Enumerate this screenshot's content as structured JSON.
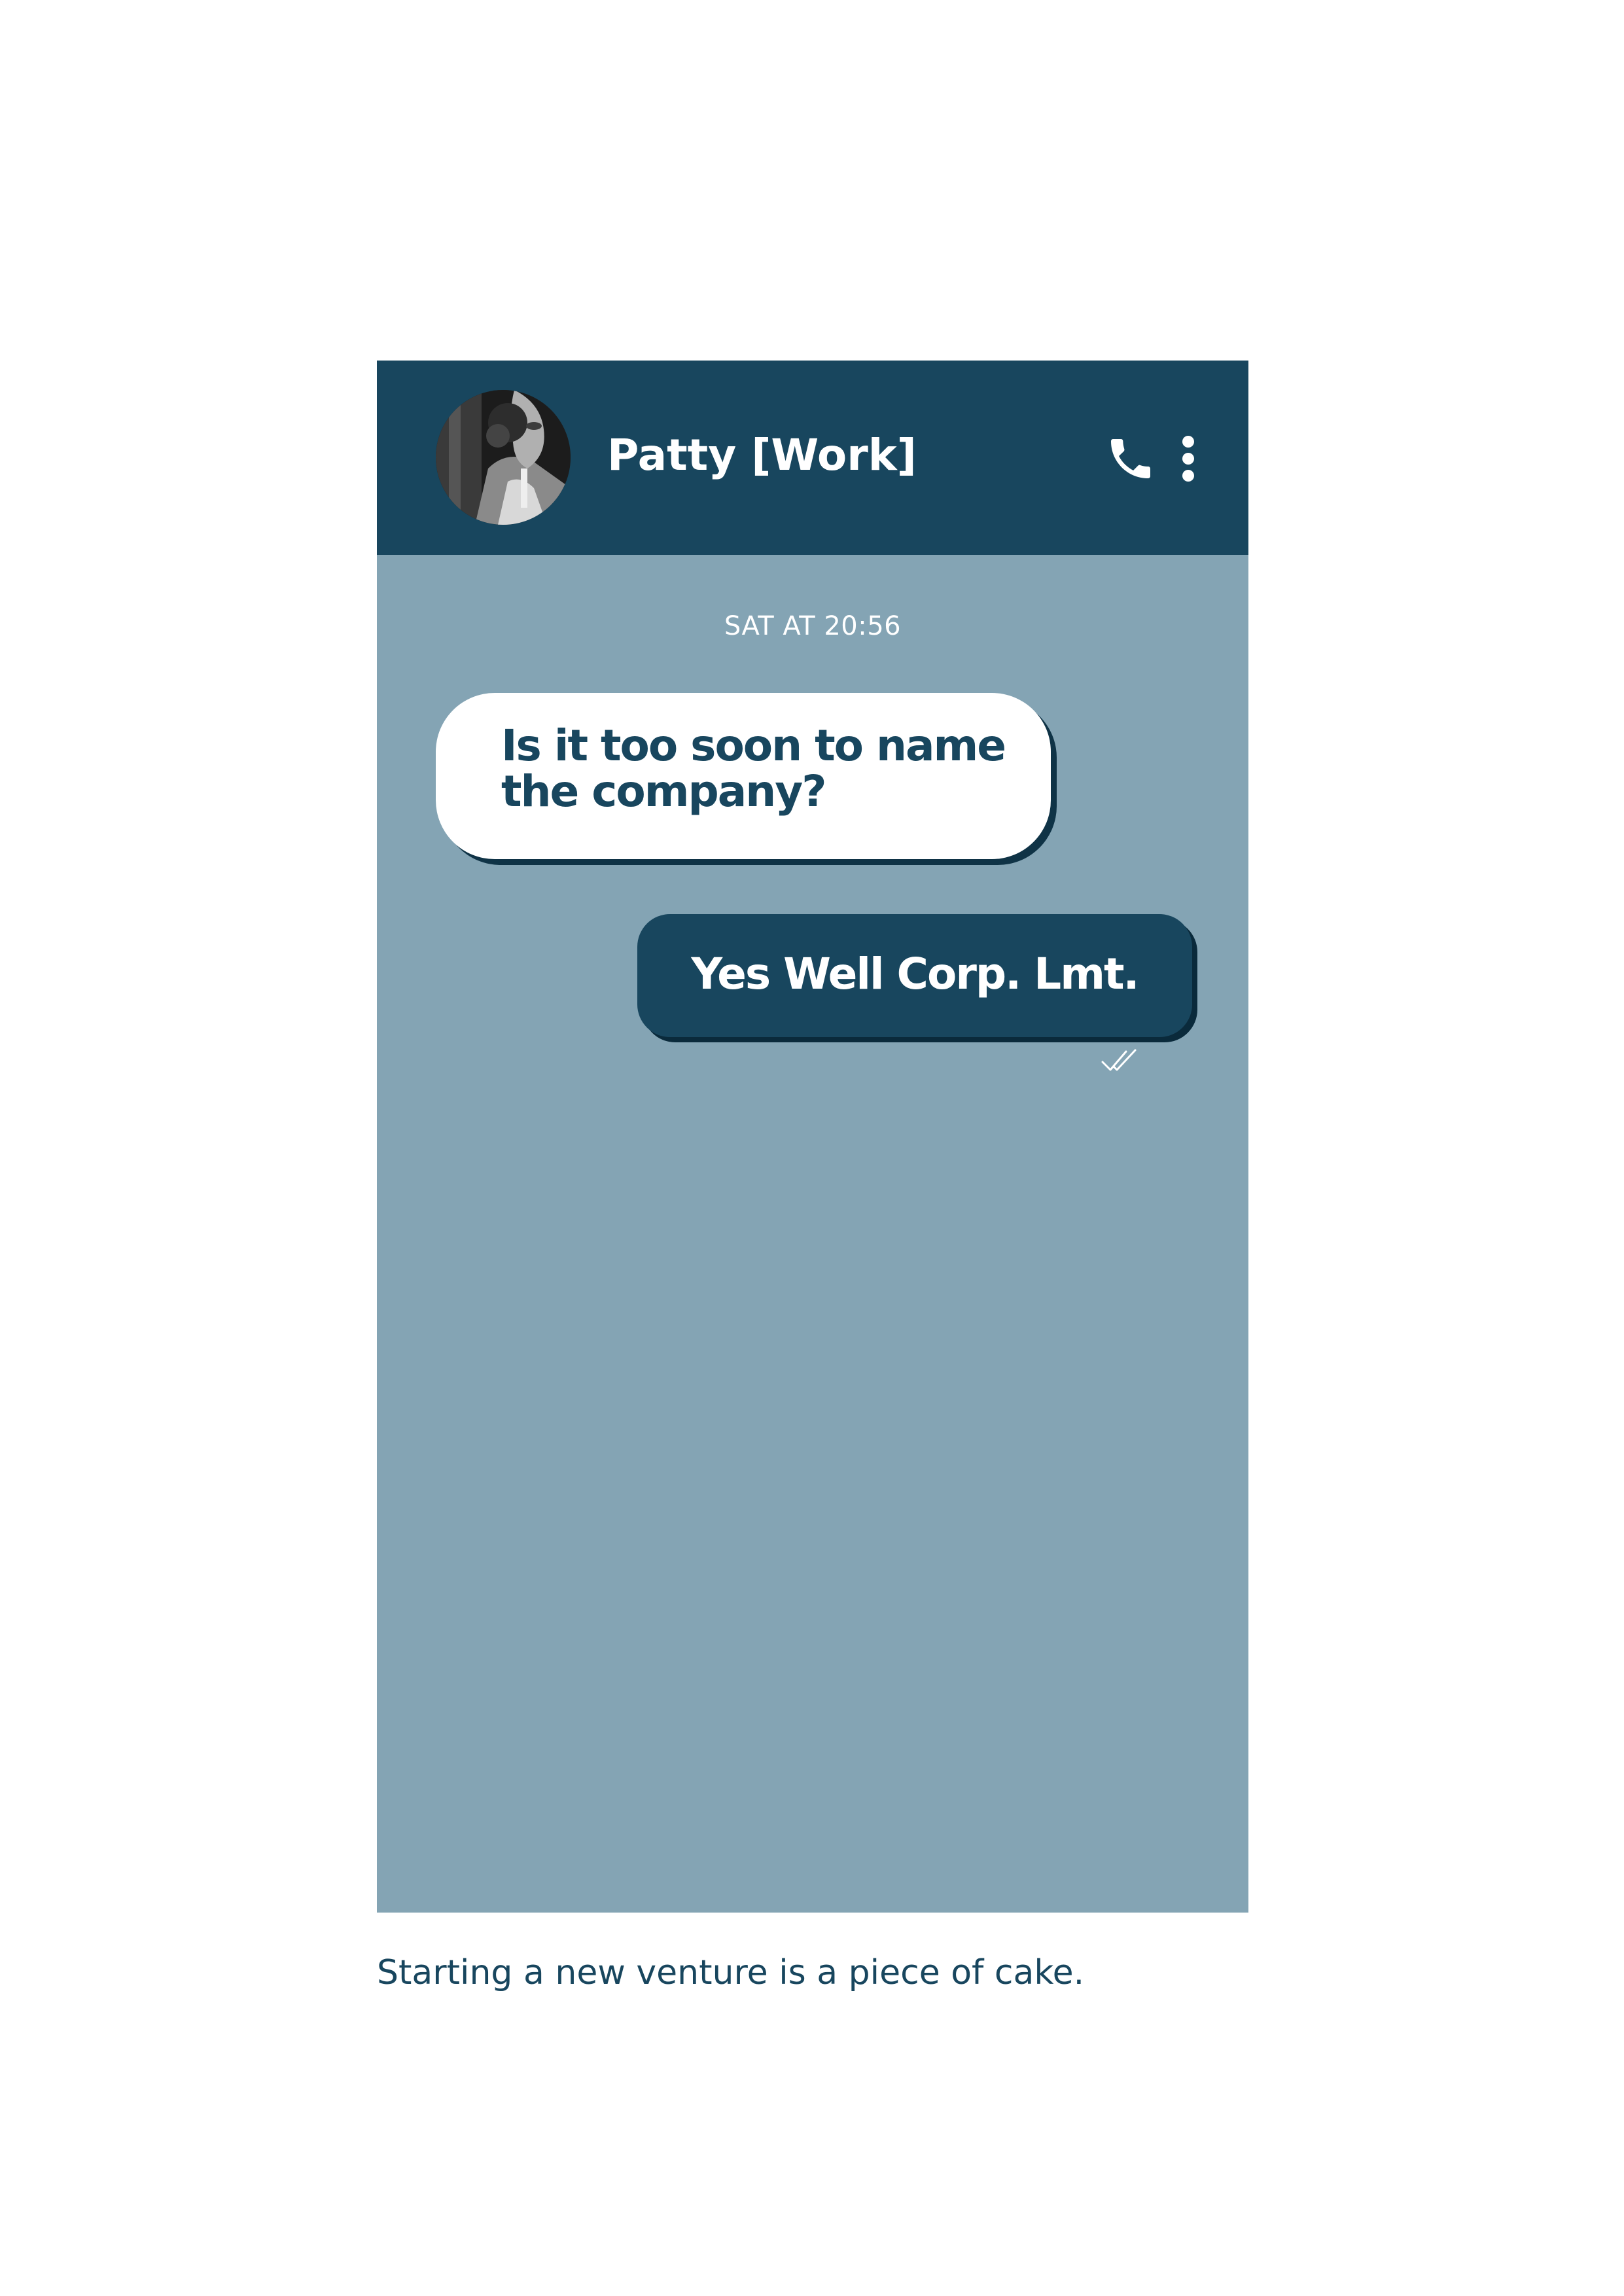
{
  "chat": {
    "contact_name": "Patty [Work]",
    "avatar_icon": "contact-avatar",
    "call_icon": "phone-icon",
    "menu_icon": "more-vertical-icon",
    "timestamp": "SAT AT 20:56",
    "messages": [
      {
        "direction": "incoming",
        "text": "Is it too soon to name the company?"
      },
      {
        "direction": "outgoing",
        "text": "Yes Well Corp. Lmt.",
        "status_icon": "double-check-icon"
      }
    ]
  },
  "caption": "Starting a new venture is a piece of cake.",
  "colors": {
    "header": "#18465e",
    "chat_background": "#84a4b4",
    "incoming_bubble": "#ffffff",
    "outgoing_bubble": "#18465e",
    "text_dark": "#18465e",
    "page_background": "#ffffff"
  }
}
